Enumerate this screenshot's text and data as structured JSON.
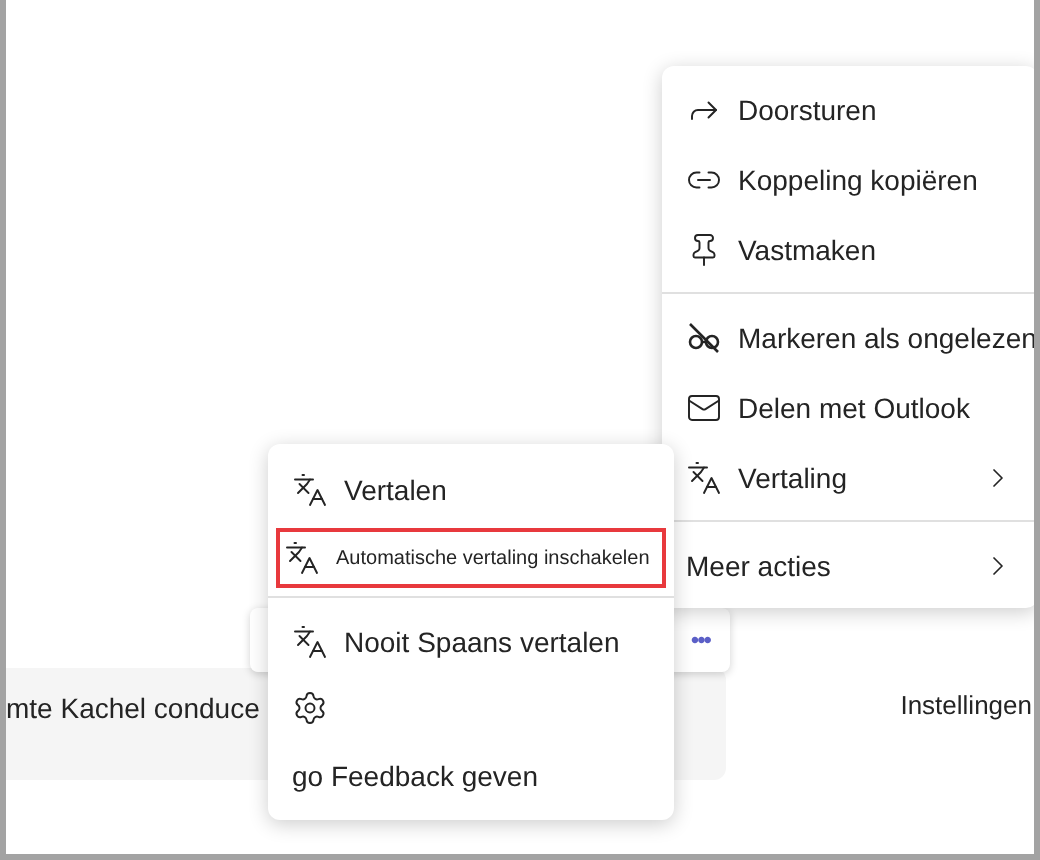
{
  "message": {
    "text": "mte Kachel conduce",
    "side_text": "Instellingen"
  },
  "reaction_bar": {
    "more": "•••"
  },
  "context_menu": {
    "items": [
      {
        "kind": "item",
        "label": "Doorsturen"
      },
      {
        "kind": "item",
        "label": "Koppeling kopiëren"
      },
      {
        "kind": "item",
        "label": "Vastmaken"
      },
      {
        "kind": "divider"
      },
      {
        "kind": "item",
        "label": "Markeren als ongelezen"
      },
      {
        "kind": "item",
        "label": "Delen met Outlook"
      },
      {
        "kind": "submenu",
        "label": "Vertaling"
      },
      {
        "kind": "divider"
      },
      {
        "kind": "submenu",
        "label": "Meer acties"
      }
    ]
  },
  "translation_menu": {
    "items": [
      {
        "kind": "item",
        "label": "Vertalen",
        "highlighted": false
      },
      {
        "kind": "item",
        "label": "Automatische vertaling inschakelen",
        "highlighted": true
      },
      {
        "kind": "divider"
      },
      {
        "kind": "item",
        "label": "Nooit Spaans vertalen",
        "highlighted": false
      },
      {
        "kind": "icon_only",
        "highlighted": false
      },
      {
        "kind": "item",
        "label": "go Feedback geven",
        "highlighted": false
      }
    ]
  }
}
